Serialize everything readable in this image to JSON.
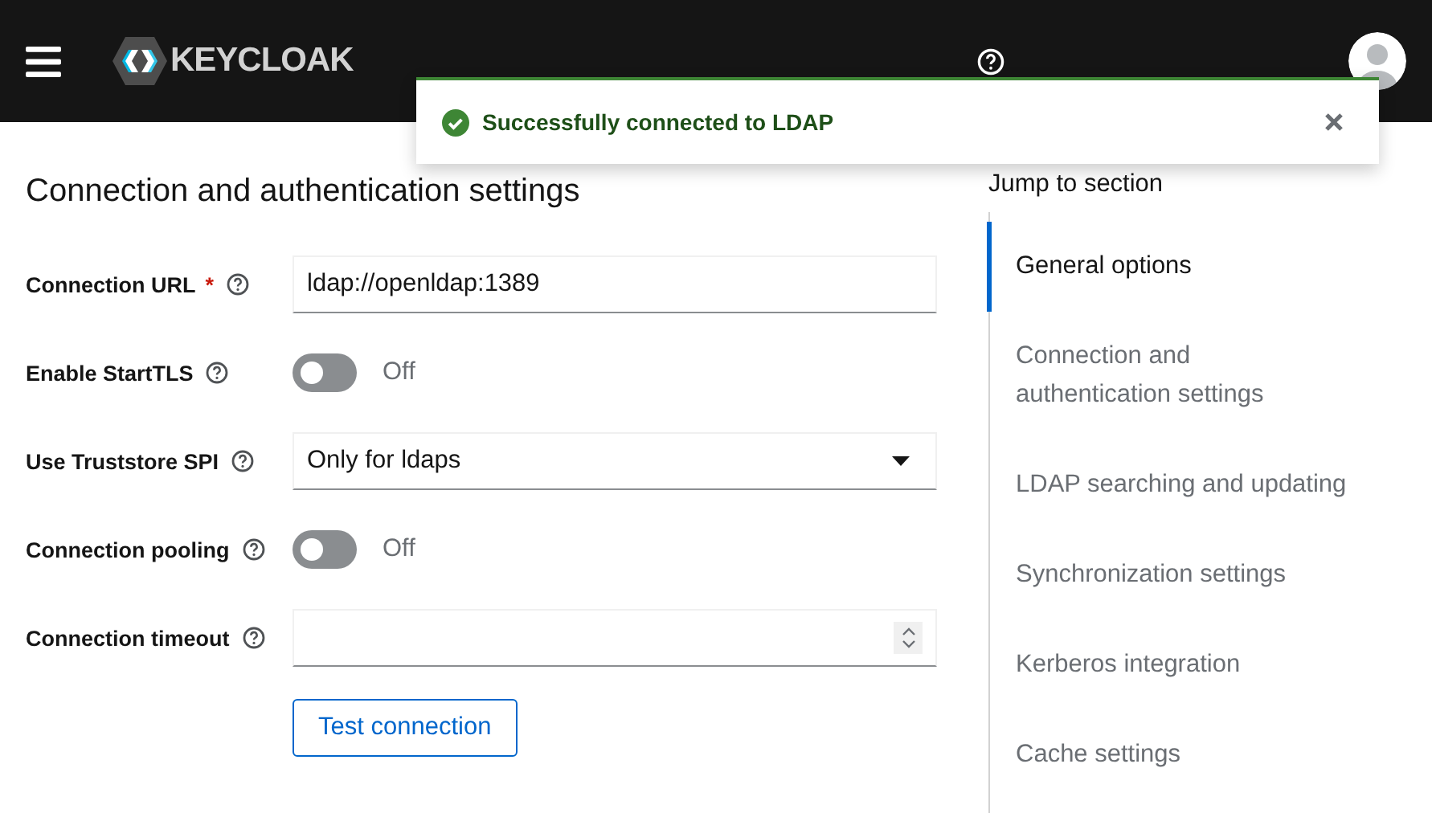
{
  "header": {
    "logo": "KEYCLOAK"
  },
  "toast": {
    "message": "Successfully connected to LDAP"
  },
  "form": {
    "title": "Connection and authentication settings",
    "fields": [
      {
        "kind": "text",
        "label": "Connection URL",
        "required_mark": "*",
        "value": "ldap://openldap:1389"
      },
      {
        "kind": "switch",
        "label": "Enable StartTLS",
        "on": false,
        "state_text": "Off"
      },
      {
        "kind": "select",
        "label": "Use Truststore SPI",
        "value": "Only for ldaps"
      },
      {
        "kind": "switch",
        "label": "Connection pooling",
        "on": false,
        "state_text": "Off"
      },
      {
        "kind": "number",
        "label": "Connection timeout"
      }
    ],
    "button": "Test connection"
  },
  "jump_nav": {
    "title": "Jump to section",
    "items": [
      {
        "label": "General options",
        "selected": true
      },
      {
        "label": "Connection and authentication settings",
        "selected": false
      },
      {
        "label": "LDAP searching and updating",
        "selected": false
      },
      {
        "label": "Synchronization settings",
        "selected": false
      },
      {
        "label": "Kerberos integration",
        "selected": false
      },
      {
        "label": "Cache settings",
        "selected": false
      }
    ]
  }
}
